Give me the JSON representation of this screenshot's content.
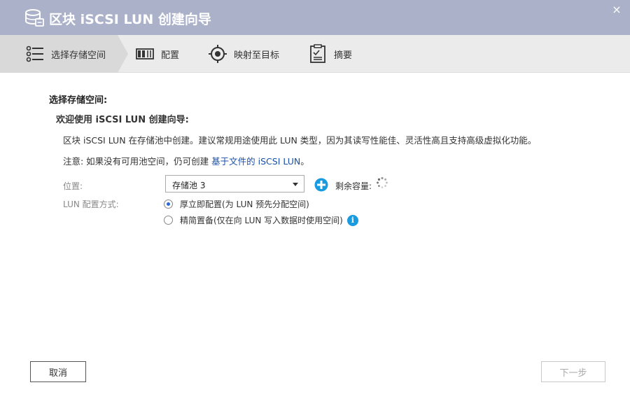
{
  "window": {
    "title": "区块 iSCSI LUN 创建向导",
    "close_glyph": "×"
  },
  "steps": [
    {
      "label": "选择存储空间",
      "icon": "list-icon",
      "active": true
    },
    {
      "label": "配置",
      "icon": "config-icon",
      "active": false
    },
    {
      "label": "映射至目标",
      "icon": "target-icon",
      "active": false
    },
    {
      "label": "摘要",
      "icon": "clipboard-icon",
      "active": false
    }
  ],
  "main": {
    "section_title": "选择存储空间:",
    "welcome": "欢迎使用 iSCSI LUN 创建向导:",
    "description": "区块 iSCSI LUN 在存储池中创建。建议常规用途使用此 LUN 类型，因为其读写性能佳、灵活性高且支持高级虚拟化功能。",
    "note_prefix": "注意: 如果没有可用池空间，仍可创建 ",
    "note_link": "基于文件的 iSCSI LUN",
    "note_suffix": "。"
  },
  "form": {
    "location_label": "位置:",
    "location_value": "存储池 3",
    "remaining_label": "剩余容量:",
    "lun_method_label": "LUN 配置方式:",
    "options": [
      {
        "label": "厚立即配置(为 LUN 预先分配空间)",
        "selected": true
      },
      {
        "label": "精简置备(仅在向 LUN 写入数据时使用空间)",
        "selected": false
      }
    ],
    "info_glyph": "i"
  },
  "footer": {
    "cancel_label": "取消",
    "next_label": "下一步"
  },
  "colors": {
    "titlebar": "#aab1c9",
    "accent": "#1a9be0",
    "link": "#1a50a8"
  }
}
